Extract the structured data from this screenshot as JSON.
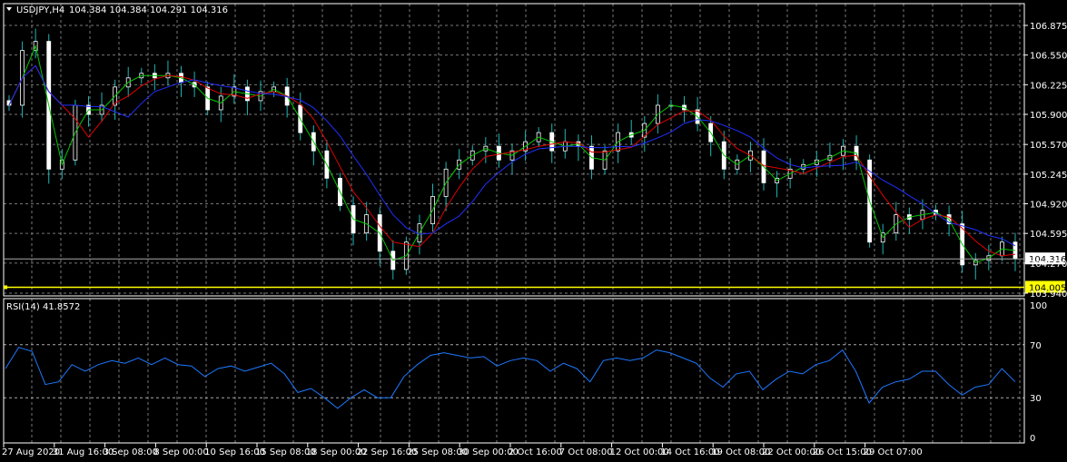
{
  "chart_data": {
    "type": "candlestick",
    "symbol": "USDJPY,H4",
    "ohlc_header": [
      "104.384",
      "104.384",
      "104.291",
      "104.316"
    ],
    "price_ticks": [
      "106.875",
      "106.550",
      "106.225",
      "105.900",
      "105.570",
      "105.245",
      "104.920",
      "104.595",
      "104.270",
      "103.940"
    ],
    "price_ticks_values": [
      106.875,
      106.55,
      106.225,
      105.9,
      105.57,
      105.245,
      104.92,
      104.595,
      104.27,
      103.94
    ],
    "ylim": [
      103.94,
      106.875
    ],
    "bid": {
      "label": "104.316",
      "value": 104.316
    },
    "hline": {
      "label": "104.005",
      "value": 104.005,
      "color": "#ffff00"
    },
    "time_labels": [
      "27 Aug 2020",
      "31 Aug 16:00",
      "3 Sep 08:00",
      "8 Sep 00:00",
      "10 Sep 16:00",
      "15 Sep 08:00",
      "18 Sep 00:00",
      "22 Sep 16:00",
      "25 Sep 08:00",
      "30 Sep 00:00",
      "2 Oct 16:00",
      "7 Oct 08:00",
      "12 Oct 00:00",
      "14 Oct 16:00",
      "19 Oct 08:00",
      "22 Oct 00:00",
      "26 Oct 15:00",
      "29 Oct 07:00"
    ],
    "closes": [
      106.0,
      106.6,
      106.7,
      105.3,
      105.4,
      106.0,
      105.9,
      106.0,
      106.2,
      106.3,
      106.35,
      106.3,
      106.35,
      106.25,
      106.2,
      105.95,
      106.1,
      106.2,
      106.05,
      106.15,
      106.2,
      106.0,
      105.7,
      105.5,
      105.2,
      104.9,
      104.6,
      104.8,
      104.4,
      104.2,
      104.5,
      104.7,
      105.0,
      105.3,
      105.4,
      105.5,
      105.55,
      105.4,
      105.5,
      105.6,
      105.7,
      105.5,
      105.6,
      105.55,
      105.3,
      105.5,
      105.7,
      105.65,
      105.8,
      106.0,
      106.0,
      105.95,
      105.8,
      105.6,
      105.3,
      105.4,
      105.5,
      105.15,
      105.2,
      105.3,
      105.35,
      105.4,
      105.45,
      105.55,
      105.4,
      104.5,
      104.6,
      104.8,
      104.75,
      104.85,
      104.8,
      104.7,
      104.25,
      104.3,
      104.35,
      104.5,
      104.316
    ],
    "ma_colors": {
      "fast": "#00c800",
      "mid": "#e00000",
      "slow": "#2030ff"
    },
    "candle_colors": {
      "bull": "#ffffff",
      "bear": "#ffffff",
      "wick": "#1fb5b5"
    },
    "rsi": {
      "label": "RSI(14) 41.8572",
      "ticks": [
        "100",
        "70",
        "30",
        "0"
      ],
      "tick_values": [
        100,
        70,
        30,
        0
      ],
      "levels": [
        70,
        30
      ],
      "color": "#1e78ff",
      "values": [
        52,
        68,
        65,
        40,
        42,
        55,
        50,
        55,
        58,
        56,
        60,
        55,
        60,
        55,
        54,
        46,
        52,
        54,
        50,
        53,
        56,
        48,
        34,
        37,
        30,
        22,
        30,
        36,
        30,
        30,
        46,
        55,
        62,
        64,
        62,
        60,
        61,
        54,
        58,
        60,
        58,
        50,
        56,
        52,
        42,
        58,
        60,
        58,
        60,
        66,
        64,
        60,
        56,
        45,
        38,
        48,
        50,
        36,
        44,
        50,
        48,
        55,
        58,
        66,
        50,
        26,
        38,
        42,
        44,
        50,
        50,
        40,
        32,
        38,
        40,
        52,
        42
      ]
    }
  }
}
